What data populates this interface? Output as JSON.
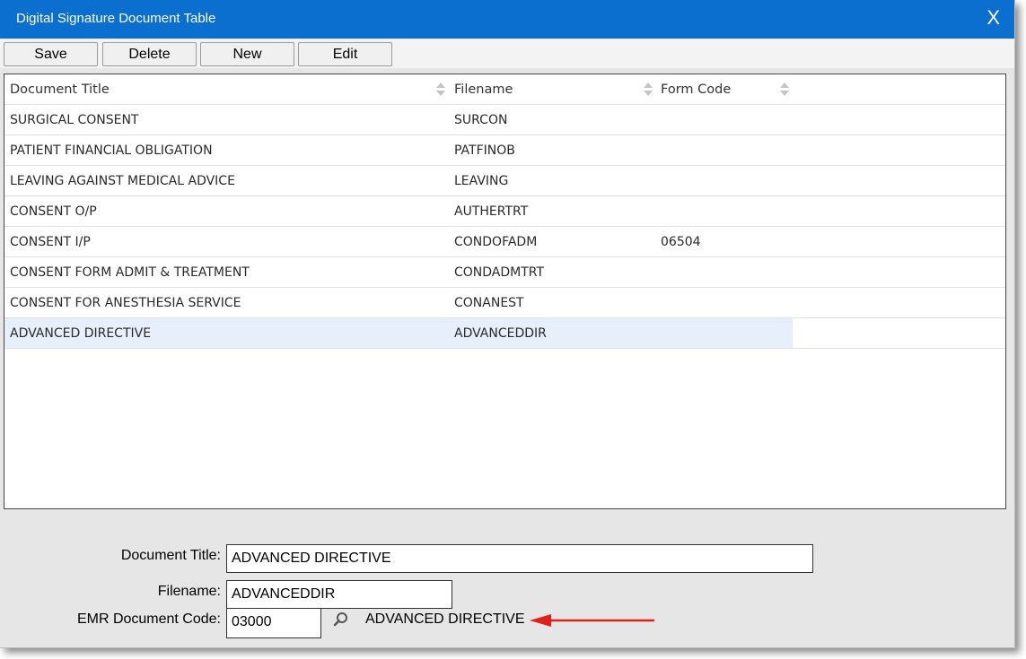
{
  "window": {
    "title": "Digital Signature Document Table",
    "close_label": "X"
  },
  "toolbar": {
    "save": "Save",
    "delete": "Delete",
    "new": "New",
    "edit": "Edit"
  },
  "table": {
    "columns": [
      "Document Title",
      "Filename",
      "Form Code"
    ],
    "rows": [
      {
        "title": "SURGICAL CONSENT",
        "filename": "SURCON",
        "form_code": ""
      },
      {
        "title": "PATIENT FINANCIAL OBLIGATION",
        "filename": "PATFINOB",
        "form_code": ""
      },
      {
        "title": "LEAVING AGAINST MEDICAL ADVICE",
        "filename": "LEAVING",
        "form_code": ""
      },
      {
        "title": "CONSENT O/P",
        "filename": "AUTHERTRT",
        "form_code": ""
      },
      {
        "title": "CONSENT I/P",
        "filename": "CONDOFADM",
        "form_code": "06504"
      },
      {
        "title": "CONSENT FORM ADMIT & TREATMENT",
        "filename": "CONDADMTRT",
        "form_code": ""
      },
      {
        "title": "CONSENT FOR ANESTHESIA SERVICE",
        "filename": "CONANEST",
        "form_code": ""
      },
      {
        "title": "ADVANCED DIRECTIVE",
        "filename": "ADVANCEDDIR",
        "form_code": ""
      }
    ],
    "selected_index": 7
  },
  "form": {
    "document_title_label": "Document Title:",
    "document_title_value": "ADVANCED DIRECTIVE",
    "filename_label": "Filename:",
    "filename_value": "ADVANCEDDIR",
    "emr_code_label": "EMR Document Code:",
    "emr_code_value": "03000",
    "emr_code_description": "ADVANCED DIRECTIVE"
  },
  "colors": {
    "titlebar": "#0b6fcf",
    "selected_row": "#e6effa",
    "arrow": "#e0201b"
  },
  "icons": {
    "lookup": "search-icon",
    "annotation": "red-arrow-icon"
  }
}
